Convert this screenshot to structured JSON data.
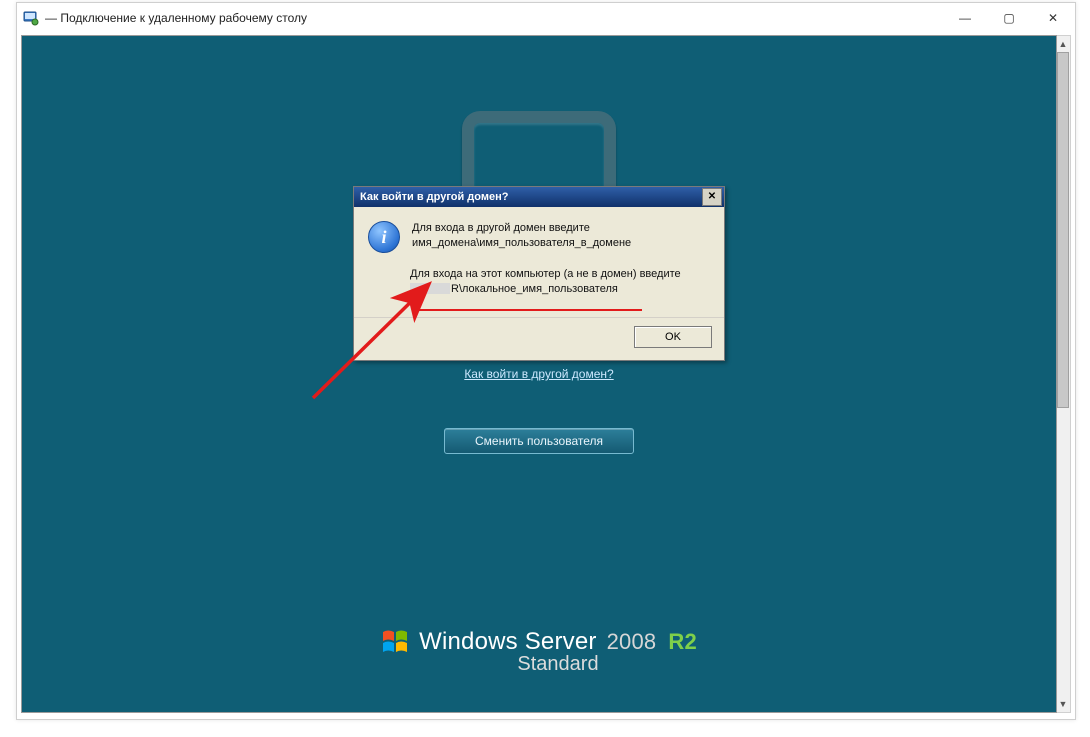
{
  "window": {
    "title": " — Подключение к удаленному рабочему столу",
    "minimize_icon": "—",
    "maximize_icon": "▢",
    "close_icon": "✕"
  },
  "dialog": {
    "title": "Как войти в другой домен?",
    "close_icon": "✕",
    "line1": "Для входа в другой домен введите",
    "line2": "имя_домена\\имя_пользователя_в_домене",
    "line3": "Для входа на этот компьютер (а не в домен) введите",
    "line4_suffix": "R\\локальное_имя_пользователя",
    "ok_label": "OK"
  },
  "login": {
    "link_text": "Как войти в другой домен?",
    "switch_user_label": "Сменить пользователя"
  },
  "branding": {
    "product": "Windows Server",
    "year": "2008",
    "r2": "R2",
    "edition": "Standard"
  },
  "info_glyph": "i"
}
